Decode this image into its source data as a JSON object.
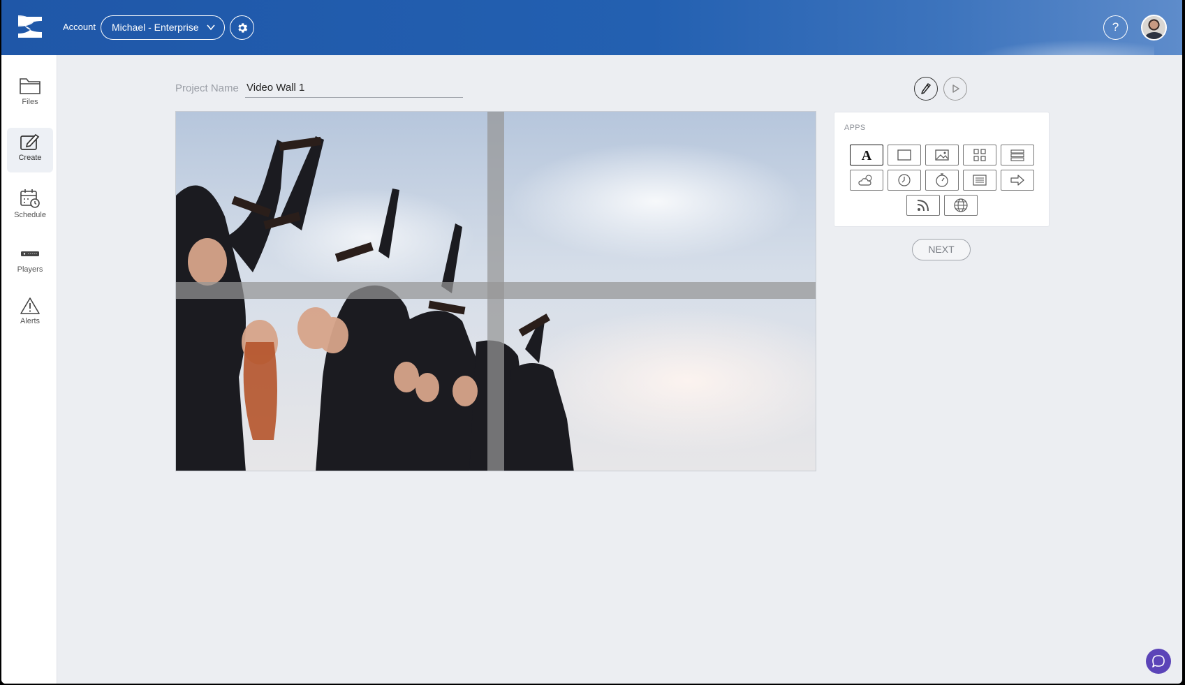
{
  "header": {
    "account_label": "Account",
    "account_value": "Michael - Enterprise",
    "help_label": "?"
  },
  "sidebar": {
    "items": [
      {
        "label": "Files",
        "icon": "folder-icon"
      },
      {
        "label": "Create",
        "icon": "create-icon",
        "active": true
      },
      {
        "label": "Schedule",
        "icon": "calendar-clock-icon"
      },
      {
        "label": "Players",
        "icon": "player-device-icon"
      },
      {
        "label": "Alerts",
        "icon": "warning-icon"
      }
    ]
  },
  "project": {
    "label": "Project Name",
    "name": "Video Wall 1"
  },
  "apps": {
    "title": "APPS",
    "items": [
      {
        "icon": "text-icon",
        "selected": true
      },
      {
        "icon": "rectangle-icon"
      },
      {
        "icon": "image-icon"
      },
      {
        "icon": "qr-code-icon"
      },
      {
        "icon": "list-layout-icon"
      },
      {
        "icon": "weather-icon"
      },
      {
        "icon": "clock-icon"
      },
      {
        "icon": "stopwatch-icon"
      },
      {
        "icon": "ticker-icon"
      },
      {
        "icon": "arrow-right-icon"
      },
      {
        "icon": "rss-icon"
      },
      {
        "icon": "globe-icon"
      }
    ]
  },
  "next_label": "NEXT",
  "colors": {
    "header": "#2360b1",
    "background": "#eceef2",
    "chat": "#5b44b8"
  }
}
